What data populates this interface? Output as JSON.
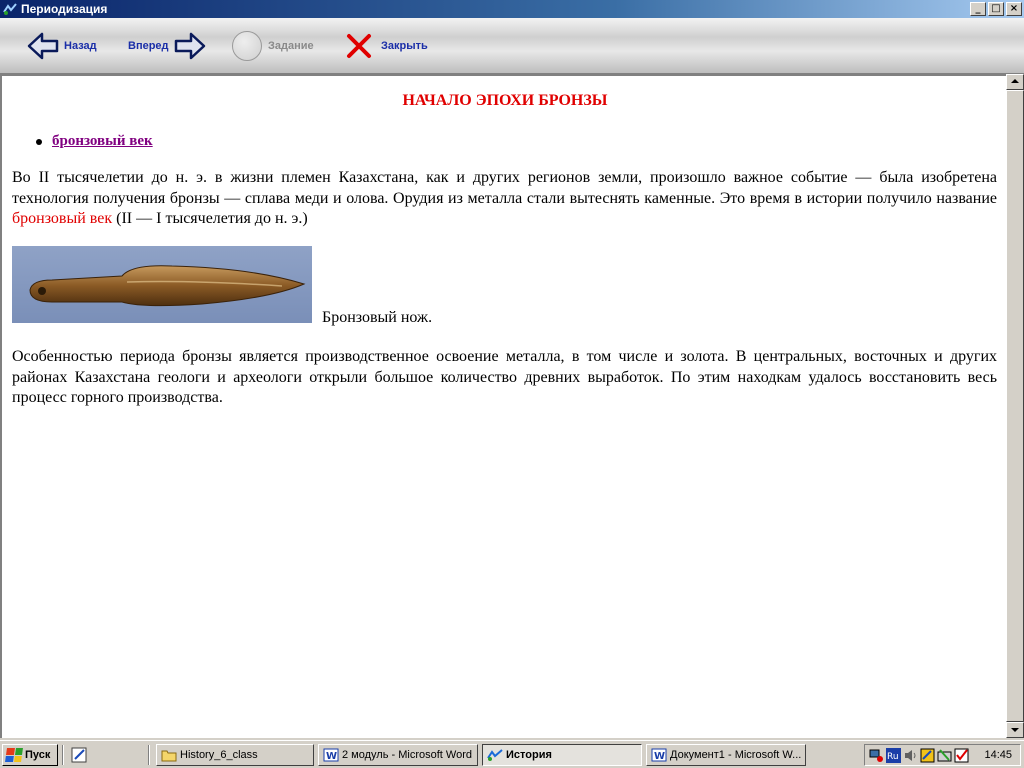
{
  "window": {
    "title": "Периодизация",
    "controls": [
      "minimize",
      "maximize",
      "close"
    ]
  },
  "toolbar": {
    "back_label": "Назад",
    "forward_label": "Вперед",
    "task_label": "Задание",
    "close_label": "Закрыть",
    "icons": [
      "arrow-left-icon",
      "arrow-right-icon",
      "circle-icon",
      "close-x-icon"
    ],
    "colors": {
      "label": "#1a2ea8",
      "disabled": "#8a8a8a",
      "close_x": "#e00000"
    }
  },
  "content": {
    "heading": "НАЧАЛО ЭПОХИ БРОНЗЫ",
    "link": "бронзовый век",
    "para1_part1": "Во II тысячелетии до н. э. в жизни племен Казахстана, как и других регионов земли, произошло важное событие — была изобретена технология получения бронзы — сплава меди и олова. Орудия из металла стали вытеснять каменные. Это время в истории получило название ",
    "para1_highlight": "бронзовый век",
    "para1_part2": " (II — I тысячелетия до н. э.)",
    "image_caption": "Бронзовый нож.",
    "para2": "Особенностью периода бронзы является производственное освоение металла, в том числе и золота. В центральных, восточных и других районах Казахстана геологи и археологи открыли большое количество древних выработок. По этим находкам удалось восстановить весь процесс горного производства.",
    "colors": {
      "heading": "#e00000",
      "link": "#800080",
      "highlight": "#e00000"
    }
  },
  "taskbar": {
    "start_label": "Пуск",
    "tasks": [
      {
        "label": "History_6_class",
        "icon": "folder-icon",
        "active": false
      },
      {
        "label": "2 модуль - Microsoft Word",
        "icon": "word-icon",
        "active": false
      },
      {
        "label": "История",
        "icon": "app-icon",
        "active": true
      },
      {
        "label": "Документ1 - Microsoft W...",
        "icon": "word-icon",
        "active": false
      }
    ],
    "tray": {
      "language": "Ru",
      "time": "14:45"
    }
  }
}
